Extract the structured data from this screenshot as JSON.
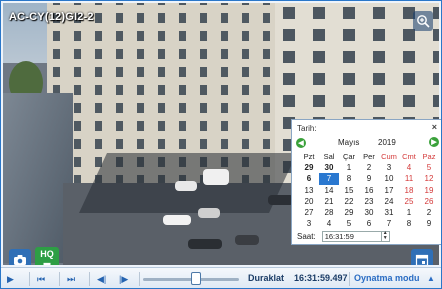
{
  "camera": {
    "title": "AC-CY(12)GI2-2",
    "zoom_icon": "magnifier-plus-icon",
    "snapshot_icon": "camera-icon",
    "hq_label": "HQ",
    "calendar_icon": "calendar-icon"
  },
  "date_picker": {
    "label": "Tarih:",
    "close_glyph": "×",
    "prev_icon": "left-arrow-icon",
    "next_icon": "right-arrow-icon",
    "month": "Mayıs",
    "year": "2019",
    "weekdays": [
      "Pzt",
      "Sal",
      "Çar",
      "Per",
      "Cum",
      "Cmt",
      "Paz"
    ],
    "weeks": [
      [
        "29",
        "30",
        "1",
        "2",
        "3",
        "4",
        "5"
      ],
      [
        "6",
        "7",
        "8",
        "9",
        "10",
        "11",
        "12"
      ],
      [
        "13",
        "14",
        "15",
        "16",
        "17",
        "18",
        "19"
      ],
      [
        "20",
        "21",
        "22",
        "23",
        "24",
        "25",
        "26"
      ],
      [
        "27",
        "28",
        "29",
        "30",
        "31",
        "1",
        "2"
      ],
      [
        "3",
        "4",
        "5",
        "6",
        "7",
        "8",
        "9"
      ]
    ],
    "selected_day": "7",
    "time_label": "Saat:",
    "time_value": "16:31:59",
    "stepper_up": "▲",
    "stepper_down": "▼"
  },
  "player": {
    "play_glyph": "▶",
    "skip_start_glyph": "⏮",
    "fast_forward_glyph": "⏭",
    "step_back_glyph": "◀|",
    "step_forward_glyph": "|▶",
    "timeline_position": 0.55,
    "status": "Duraklat",
    "timestamp": "16:31:59.497",
    "mode_label": "Oynatma modu",
    "mode_dropdown_glyph": "▲",
    "accent_color": "#2a6cc3"
  }
}
